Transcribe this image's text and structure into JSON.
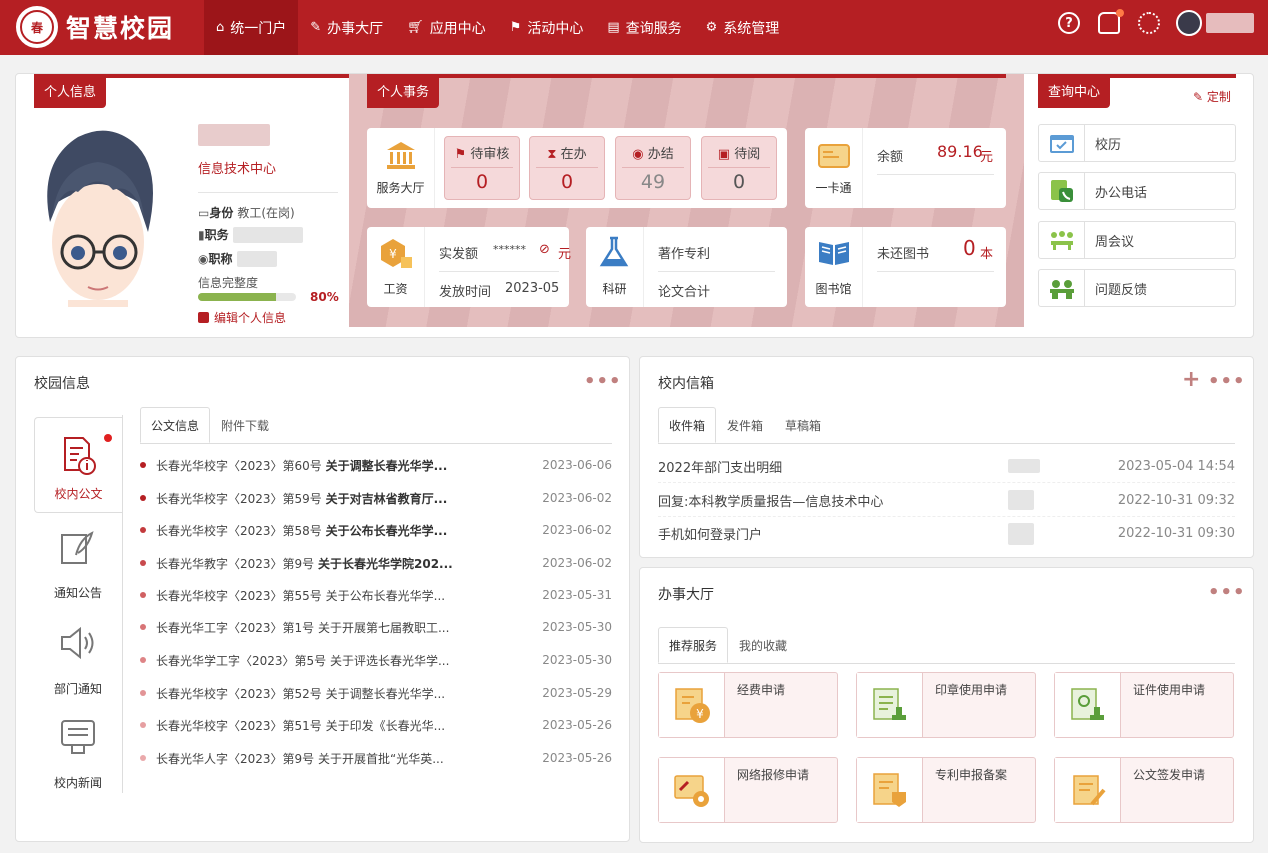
{
  "brand": {
    "title": "智慧校园",
    "seal_text": "春"
  },
  "nav": [
    {
      "label": "统一门户",
      "icon": "home-icon"
    },
    {
      "label": "办事大厅",
      "icon": "edit-icon"
    },
    {
      "label": "应用中心",
      "icon": "cart-icon"
    },
    {
      "label": "活动中心",
      "icon": "flag-icon"
    },
    {
      "label": "查询服务",
      "icon": "list-icon"
    },
    {
      "label": "系统管理",
      "icon": "gear-icon"
    }
  ],
  "top": {
    "help": "?"
  },
  "personal": {
    "tag": "个人信息",
    "dept": "信息技术中心",
    "identity_label": "身份",
    "identity_value": "教工(在岗)",
    "post_label": "职务",
    "title_label": "职称",
    "completeness_label": "信息完整度",
    "completeness_pct": "80%",
    "completeness_value": 0.8,
    "edit_label": "编辑个人信息"
  },
  "affairs": {
    "tag": "个人事务",
    "service_hall": "服务大厅",
    "boxes": [
      {
        "title": "待审核",
        "count": "0",
        "icon": "flag-icon"
      },
      {
        "title": "在办",
        "count": "0",
        "icon": "hourglass-icon"
      },
      {
        "title": "办结",
        "count": "49",
        "icon": "check-circle-icon"
      },
      {
        "title": "待阅",
        "count": "0",
        "icon": "document-icon"
      }
    ],
    "card": {
      "label": "一卡通",
      "balance_label": "余额",
      "balance": "89.16",
      "unit": "元"
    },
    "salary": {
      "label": "工资",
      "paid_label": "实发额",
      "paid_value": "******",
      "unit": "元",
      "time_label": "发放时间",
      "time_value": "2023-05"
    },
    "research": {
      "label": "科研",
      "patent": "著作专利",
      "paper": "论文合计"
    },
    "library": {
      "label": "图书馆",
      "unreturned_label": "未还图书",
      "count": "0",
      "unit": "本"
    }
  },
  "query": {
    "tag": "查询中心",
    "customize": "定制",
    "items": [
      {
        "label": "校历",
        "icon": "calendar-icon"
      },
      {
        "label": "办公电话",
        "icon": "phone-icon"
      },
      {
        "label": "周会议",
        "icon": "meeting-icon"
      },
      {
        "label": "问题反馈",
        "icon": "feedback-icon"
      }
    ]
  },
  "campus": {
    "title": "校园信息",
    "more": "•••",
    "vtabs": [
      "校内公文",
      "通知公告",
      "部门通知",
      "校内新闻"
    ],
    "htabs": [
      "公文信息",
      "附件下载"
    ],
    "news": [
      {
        "pre": "长春光华校字〈2023〉第60号 ",
        "bold": "关于调整长春光华学...",
        "date": "2023-06-06"
      },
      {
        "pre": "长春光华校字〈2023〉第59号 ",
        "bold": "关于对吉林省教育厅...",
        "date": "2023-06-02"
      },
      {
        "pre": "长春光华校字〈2023〉第58号 ",
        "bold": "关于公布长春光华学...",
        "date": "2023-06-02"
      },
      {
        "pre": "长春光华教字〈2023〉第9号 ",
        "bold": "关于长春光华学院202...",
        "date": "2023-06-02"
      },
      {
        "pre": "长春光华校字〈2023〉第55号 关于公布长春光华学...",
        "bold": "",
        "date": "2023-05-31"
      },
      {
        "pre": "长春光华工字〈2023〉第1号 关于开展第七届教职工...",
        "bold": "",
        "date": "2023-05-30"
      },
      {
        "pre": "长春光华学工字〈2023〉第5号 关于评选长春光华学...",
        "bold": "",
        "date": "2023-05-30"
      },
      {
        "pre": "长春光华校字〈2023〉第52号 关于调整长春光华学...",
        "bold": "",
        "date": "2023-05-29"
      },
      {
        "pre": "长春光华校字〈2023〉第51号 关于印发《长春光华...",
        "bold": "",
        "date": "2023-05-26"
      },
      {
        "pre": "长春光华人字〈2023〉第9号 关于开展首批“光华英...",
        "bold": "",
        "date": "2023-05-26"
      }
    ]
  },
  "mailbox": {
    "title": "校内信箱",
    "add": "+",
    "more": "•••",
    "tabs": [
      "收件箱",
      "发件箱",
      "草稿箱"
    ],
    "items": [
      {
        "subject": "2022年部门支出明细",
        "date": "2023-05-04 14:54"
      },
      {
        "subject": "回复:本科教学质量报告—信息技术中心",
        "date": "2022-10-31 09:32"
      },
      {
        "subject": "手机如何登录门户",
        "date": "2022-10-31 09:30"
      }
    ]
  },
  "hall": {
    "title": "办事大厅",
    "more": "•••",
    "tabs": [
      "推荐服务",
      "我的收藏"
    ],
    "services": [
      {
        "label": "经费申请",
        "icon": "funding-icon"
      },
      {
        "label": "印章使用申请",
        "icon": "seal-icon"
      },
      {
        "label": "证件使用申请",
        "icon": "certificate-icon"
      },
      {
        "label": "网络报修申请",
        "icon": "repair-icon"
      },
      {
        "label": "专利申报备案",
        "icon": "patent-icon"
      },
      {
        "label": "公文签发申请",
        "icon": "sign-document-icon"
      }
    ]
  },
  "colors": {
    "primary": "#b51f23",
    "accent": "#e9a23b"
  }
}
